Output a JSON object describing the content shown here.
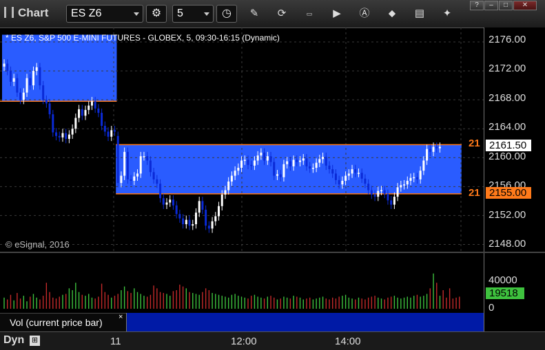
{
  "window": {
    "title": "Chart",
    "controls": [
      "?",
      "–",
      "□",
      "✕"
    ]
  },
  "toolbar": {
    "symbol": "ES Z6",
    "interval": "5"
  },
  "chart": {
    "title": "* ES Z6, S&P 500 E-MINI FUTURES - GLOBEX, 5, 09:30-16:15 (Dynamic)",
    "copyright": "© eSignal, 2016",
    "price_labels": [
      "2176.00",
      "2172.00",
      "2168.00",
      "2164.00",
      "2160.00",
      "2156.00",
      "2152.00",
      "2148.00"
    ],
    "current_price": "2161.50",
    "level_price": "2155.00",
    "level_tag": "21",
    "time_labels": [
      "11",
      "12:00",
      "14:00"
    ],
    "colors": {
      "band": "#2a5cff",
      "up": "#ffffff",
      "down": "#0a2ad6",
      "level": "#ff7a1a",
      "vol_up": "#3ec23e",
      "vol_down": "#c42a2a",
      "vol_current": "#3ec23e"
    }
  },
  "volume": {
    "legend": "Vol (current price bar)",
    "close": "×",
    "axis_labels": [
      "40000",
      "0"
    ],
    "current_value": "19518"
  },
  "footer": {
    "mode": "Dyn"
  },
  "chart_data": {
    "type": "candlestick",
    "ylim": [
      2147,
      2178
    ],
    "ticks": [
      2148,
      2152,
      2156,
      2160,
      2164,
      2168,
      2172,
      2176
    ],
    "bands": [
      {
        "from": 0,
        "to": 34,
        "low": 2167.8,
        "high": 2177
      },
      {
        "from": 35,
        "to": 140,
        "low": 2155,
        "high": 2161.8
      }
    ],
    "levels": [
      2161.8,
      2155.0
    ],
    "closes": [
      2173,
      2172,
      2170.5,
      2171,
      2169,
      2168,
      2169,
      2171,
      2170,
      2172,
      2172.5,
      2170,
      2168,
      2167.5,
      2166,
      2163.5,
      2163,
      2162.8,
      2163.4,
      2162.6,
      2163.2,
      2164,
      2165.5,
      2166.7,
      2165.8,
      2166.6,
      2167.2,
      2167.8,
      2166.8,
      2166.2,
      2164.4,
      2163.6,
      2162.9,
      2163.8,
      2163.6,
      2156.5,
      2157.5,
      2160.8,
      2157,
      2156.8,
      2157.4,
      2157.8,
      2160.2,
      2160.2,
      2159.6,
      2158,
      2157,
      2156.4,
      2154.4,
      2153.5,
      2153.8,
      2154.2,
      2153.4,
      2152.2,
      2151.6,
      2150.8,
      2151.4,
      2150.6,
      2150.8,
      2152.4,
      2154,
      2152.8,
      2150.6,
      2150.2,
      2151.2,
      2151.9,
      2153.3,
      2154.9,
      2155.5,
      2156.7,
      2157.5,
      2158.2,
      2158.6,
      2159.6,
      2159.7,
      2159,
      2158.9,
      2159.6,
      2160.3,
      2160.7,
      2159.6,
      2160.2,
      2159.4,
      2157.5,
      2157.7,
      2157.3,
      2159.1,
      2159.5,
      2158.8,
      2159.7,
      2159.4,
      2159.6,
      2159.9,
      2158.8,
      2158.5,
      2158.6,
      2159.3,
      2159.8,
      2160.1,
      2158.9,
      2158.4,
      2157.8,
      2156.9,
      2156.3,
      2156.8,
      2157.5,
      2157.8,
      2158.4,
      2157.9,
      2157.9,
      2157.1,
      2156.4,
      2155.5,
      2154.9,
      2154.6,
      2155.4,
      2155.5,
      2155,
      2154.1,
      2153.5,
      2154.6,
      2155.9,
      2156.2,
      2156.3,
      2156.8,
      2157.2,
      2157.3,
      2157,
      2158.2,
      2159.6,
      2161.2,
      2160.8,
      2161.5,
      2161.3,
      2161.5
    ],
    "volumes": [
      12,
      10,
      15,
      9,
      17,
      11,
      14,
      8,
      13,
      16,
      12,
      10,
      14,
      28,
      18,
      12,
      11,
      13,
      15,
      16,
      22,
      20,
      28,
      18,
      15,
      14,
      16,
      12,
      11,
      13,
      27,
      18,
      15,
      12,
      14,
      16,
      20,
      24,
      19,
      17,
      22,
      18,
      16,
      14,
      13,
      15,
      25,
      22,
      18,
      17,
      16,
      14,
      19,
      20,
      26,
      24,
      22,
      18,
      17,
      16,
      15,
      18,
      22,
      20,
      17,
      16,
      15,
      14,
      13,
      12,
      15,
      16,
      14,
      13,
      12,
      11,
      14,
      15,
      13,
      12,
      11,
      13,
      14,
      12,
      10,
      11,
      13,
      12,
      11,
      14,
      13,
      12,
      10,
      11,
      12,
      10,
      11,
      12,
      13,
      11,
      10,
      12,
      11,
      13,
      14,
      15,
      12,
      11,
      10,
      12,
      11,
      10,
      12,
      13,
      14,
      12,
      11,
      10,
      12,
      13,
      14,
      12,
      11,
      12,
      13,
      12,
      14,
      15,
      13,
      14,
      16,
      22,
      38,
      28,
      14,
      20,
      12,
      22,
      11,
      12,
      13
    ],
    "volume_scale": 60000
  }
}
